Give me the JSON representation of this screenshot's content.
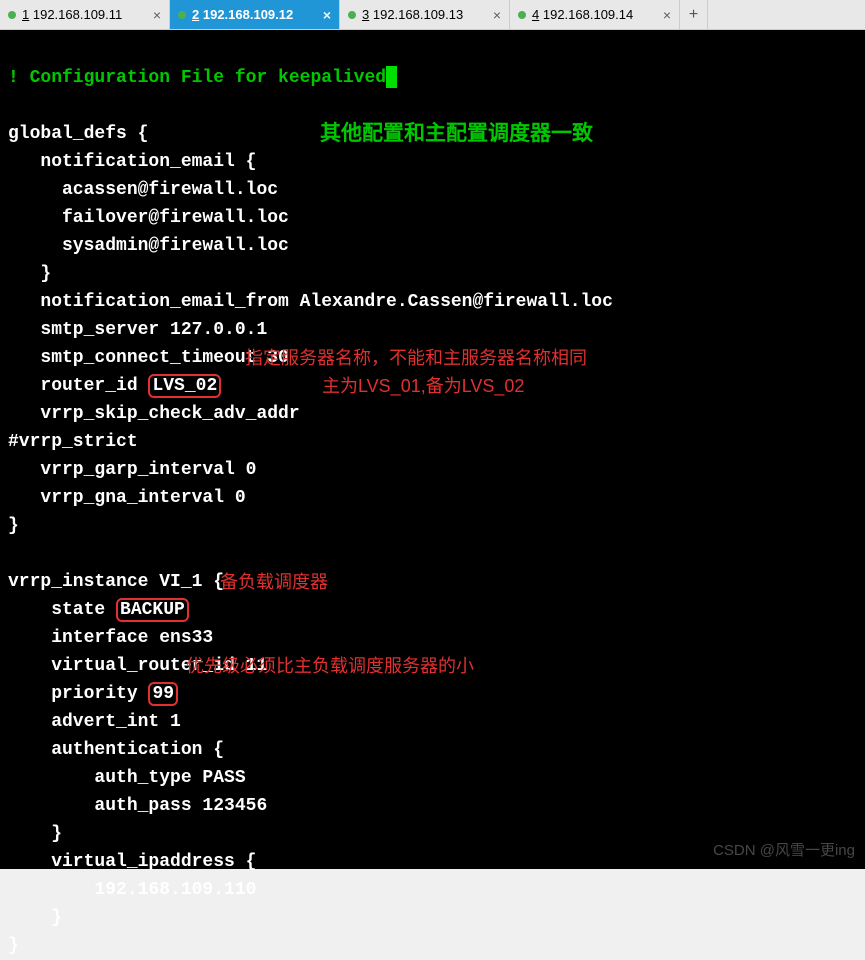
{
  "tabs": [
    {
      "num": "1",
      "label": "192.168.109.11",
      "active": false
    },
    {
      "num": "2",
      "label": "192.168.109.12",
      "active": true
    },
    {
      "num": "3",
      "label": "192.168.109.13",
      "active": false
    },
    {
      "num": "4",
      "label": "192.168.109.14",
      "active": false
    }
  ],
  "term": {
    "l0": "! Configuration File for keepalived",
    "l2": "global_defs {",
    "l3": "   notification_email {",
    "l4": "     acassen@firewall.loc",
    "l5": "     failover@firewall.loc",
    "l6": "     sysadmin@firewall.loc",
    "l7": "   }",
    "l8": "   notification_email_from Alexandre.Cassen@firewall.loc",
    "l9": "   smtp_server 127.0.0.1",
    "l10": "   smtp_connect_timeout 30",
    "l11a": "   router_id ",
    "l11box": "LVS_02",
    "l12": "   vrrp_skip_check_adv_addr",
    "l13": "#vrrp_strict",
    "l14": "   vrrp_garp_interval 0",
    "l15": "   vrrp_gna_interval 0",
    "l16": "}",
    "l18": "vrrp_instance VI_1 {",
    "l19a": "    state ",
    "l19box": "BACKUP",
    "l20": "    interface ens33",
    "l21": "    virtual_router_id 11",
    "l22a": "    priority ",
    "l22box": "99",
    "l23": "    advert_int 1",
    "l24": "    authentication {",
    "l25": "        auth_type PASS",
    "l26": "        auth_pass 123456",
    "l27": "    }",
    "l28": "    virtual_ipaddress {",
    "l29": "        192.168.109.110",
    "l30": "    }",
    "l31": "}"
  },
  "anno": {
    "a1": "其他配置和主配置调度器一致",
    "a2a": "指定服务器名称，不能和主服务器名称相同",
    "a2b": "主为LVS_01,备为LVS_02",
    "a3": "备负载调度器",
    "a4": "优先级必须比主负载调度服务器的小"
  },
  "watermark": "CSDN @风雪一更ing"
}
